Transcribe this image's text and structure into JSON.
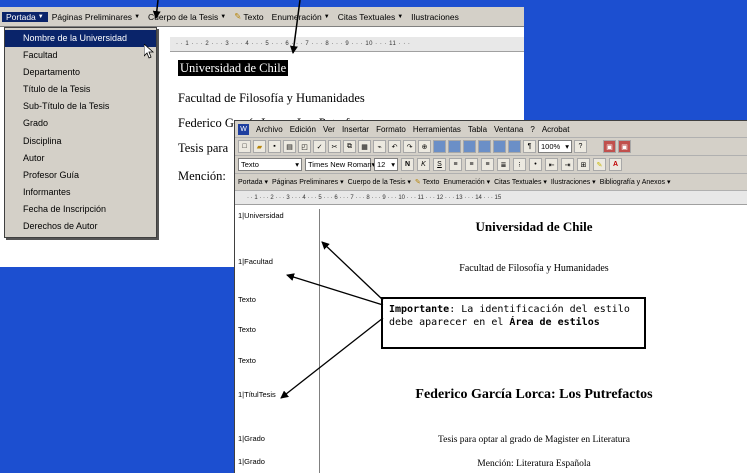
{
  "back_window": {
    "menubar": [
      {
        "label": "Portada",
        "active": true
      },
      {
        "label": "Páginas Preliminares",
        "active": false
      },
      {
        "label": "Cuerpo de la Tesis",
        "active": false
      },
      {
        "label": "Texto",
        "active": false
      },
      {
        "label": "Enumeración",
        "active": false
      },
      {
        "label": "Citas Textuales",
        "active": false
      },
      {
        "label": "Ilustraciones",
        "active": false
      }
    ],
    "ruler": "· · 1 · · · 2 · · · 3 · · · 4 · · · 5 · · · 6 · · · 7 · · · 8 · · · 9 · · · 10 · · · 11 · · ·",
    "doc_lines": [
      "Universidad de Chile",
      "Facultad de Filosofía y Humanidades",
      "Federico García Lorca: Los Putrefactos",
      "Tesis para",
      "Mención:"
    ]
  },
  "dropdown": {
    "items": [
      "Nombre de la Universidad",
      "Facultad",
      "Departamento",
      "Título de la Tesis",
      "Sub-Título de la Tesis",
      "Grado",
      "Disciplina",
      "Autor",
      "Profesor Guía",
      "Informantes",
      "Fecha de Inscripción",
      "Derechos de Autor"
    ],
    "highlighted_index": 0
  },
  "front_window": {
    "menu": [
      "Archivo",
      "Edición",
      "Ver",
      "Insertar",
      "Formato",
      "Herramientas",
      "Tabla",
      "Ventana",
      "?",
      "Acrobat"
    ],
    "formatting": {
      "style_box": "Texto",
      "font_box": "Times New Roman",
      "size_box": "12",
      "zoom_box": "100%"
    },
    "custom_toolbar": [
      "Portada",
      "Páginas Preliminares",
      "Cuerpo de la Tesis",
      "Texto",
      "Enumeración",
      "Citas Textuales",
      "Ilustraciones",
      "Bibliografía y Anexos"
    ],
    "ruler": "· · 1 · · · 2 · · · 3 · · · 4 · · · 5 · · · 6 · · · 7 · · · 8 · · · 9 · · · 10 · · · 11 · · · 12 · · · 13 · · · 14 · · · 15",
    "style_area": [
      "1|Universidad",
      "1|Facultad",
      "Texto",
      "Texto",
      "Texto",
      "1|TítulTesis",
      "1|Grado",
      "1|Grado"
    ],
    "doc_lines": [
      "Universidad de Chile",
      "Facultad de Filosofía y Humanidades",
      "Federico García Lorca: Los Putrefactos",
      "Tesis para optar al grado de Magister en Literatura",
      "Mención: Literatura Española"
    ]
  },
  "callout": {
    "bold_1": "Importante",
    "text_1": ":  La identificación del estilo debe aparecer en el ",
    "bold_2": "Área de estilos"
  },
  "colors": {
    "desktop": "#1c4fd0",
    "menu_highlight": "#0a246a",
    "chrome": "#d4d0c8"
  }
}
